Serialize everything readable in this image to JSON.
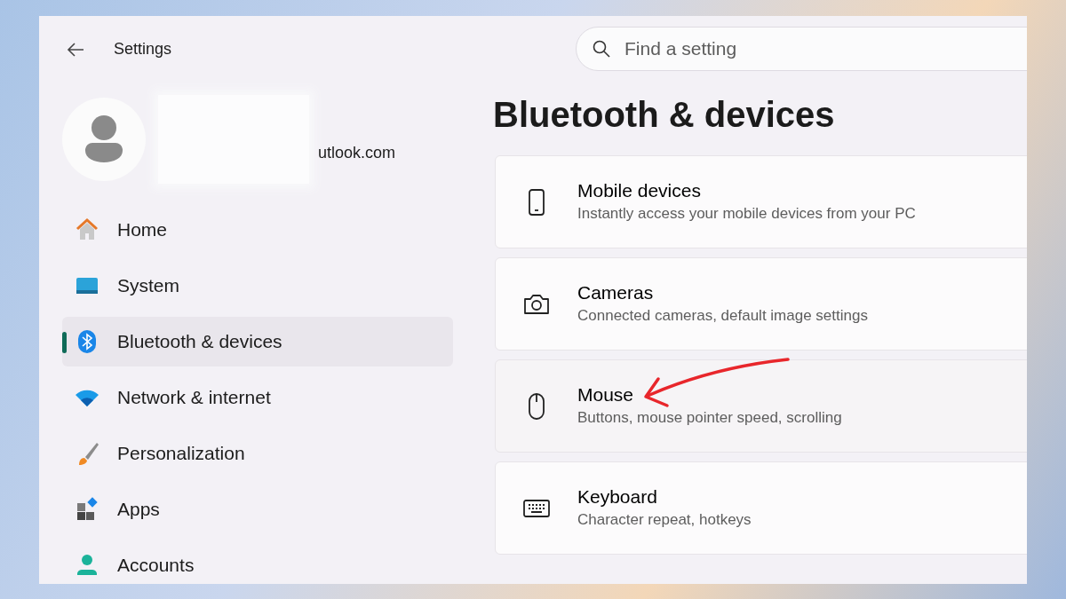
{
  "window": {
    "title": "Settings"
  },
  "search": {
    "placeholder": "Find a setting"
  },
  "account": {
    "email": "utlook.com"
  },
  "sidebar": {
    "items": [
      {
        "label": "Home",
        "selected": false
      },
      {
        "label": "System",
        "selected": false
      },
      {
        "label": "Bluetooth & devices",
        "selected": true
      },
      {
        "label": "Network & internet",
        "selected": false
      },
      {
        "label": "Personalization",
        "selected": false
      },
      {
        "label": "Apps",
        "selected": false
      },
      {
        "label": "Accounts",
        "selected": false
      }
    ]
  },
  "page": {
    "title": "Bluetooth & devices"
  },
  "cards": [
    {
      "title": "Mobile devices",
      "subtitle": "Instantly access your mobile devices from your PC",
      "annotated": false
    },
    {
      "title": "Cameras",
      "subtitle": "Connected cameras, default image settings",
      "annotated": false
    },
    {
      "title": "Mouse",
      "subtitle": "Buttons, mouse pointer speed, scrolling",
      "annotated": true
    },
    {
      "title": "Keyboard",
      "subtitle": "Character repeat, hotkeys",
      "annotated": false
    }
  ]
}
